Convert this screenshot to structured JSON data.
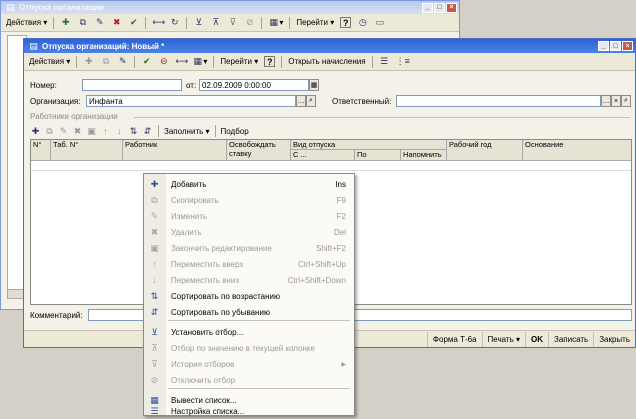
{
  "back_window": {
    "title": "Отпуска организации",
    "actions_label": "Действия",
    "goto_label": "Перейти"
  },
  "front_window": {
    "title": "Отпуска организаций: Новый *",
    "actions_label": "Действия",
    "goto_label": "Перейти",
    "open_accruals_label": "Открыть начисления",
    "number_label": "Номер:",
    "number_value": "",
    "date_prefix": "от:",
    "date_value": "02.09.2009  0:00:00",
    "org_label": "Организация:",
    "org_value": "Инфанта",
    "responsible_label": "Ответственный:",
    "responsible_value": "",
    "section_label": "Работники организации",
    "fill_label": "Заполнить",
    "select_label": "Подбор",
    "columns": {
      "num": "N°",
      "tab": "Таб. N°",
      "worker": "Работник",
      "free": "Освобождать ставку",
      "vacation_type": "Вид отпуска",
      "from": "С ...",
      "to": "По",
      "remind": "Напомнить",
      "work_year": "Рабочий год",
      "basis": "Основание"
    },
    "comment_label": "Комментарий:",
    "comment_value": "",
    "status": {
      "form": "Форма Т-6а",
      "print": "Печать",
      "ok": "OK",
      "write": "Записать",
      "close": "Закрыть"
    }
  },
  "menu": {
    "items": [
      {
        "label": "Добавить",
        "key": "Ins",
        "icon": "add-icon",
        "disabled": false
      },
      {
        "label": "Скопировать",
        "key": "F9",
        "icon": "copy-icon",
        "disabled": true
      },
      {
        "label": "Изменить",
        "key": "F2",
        "icon": "edit-icon",
        "disabled": true
      },
      {
        "label": "Удалить",
        "key": "Del",
        "icon": "delete-icon",
        "disabled": true
      },
      {
        "label": "Закончить редактирование",
        "key": "Shift+F2",
        "icon": "finish-edit-icon",
        "disabled": true
      },
      {
        "label": "Переместить вверх",
        "key": "Ctrl+Shift+Up",
        "icon": "arrow-up-icon",
        "disabled": true
      },
      {
        "label": "Переместить вниз",
        "key": "Ctrl+Shift+Down",
        "icon": "arrow-down-icon",
        "disabled": true
      },
      {
        "label": "Сортировать по возрастанию",
        "key": "",
        "icon": "sort-asc-icon",
        "disabled": false
      },
      {
        "label": "Сортировать по убыванию",
        "key": "",
        "icon": "sort-desc-icon",
        "disabled": false
      },
      {
        "label": "Установить отбор...",
        "key": "",
        "icon": "filter-icon",
        "disabled": false
      },
      {
        "label": "Отбор по значению в текущей колонке",
        "key": "",
        "icon": "filter-value-icon",
        "disabled": true
      },
      {
        "label": "История отборов",
        "key": "",
        "icon": "filter-history-icon",
        "disabled": true
      },
      {
        "label": "Отключить отбор",
        "key": "",
        "icon": "filter-off-icon",
        "disabled": true
      },
      {
        "label": "Вывести список...",
        "key": "",
        "icon": "list-output-icon",
        "disabled": false
      },
      {
        "label": "Настройка списка...",
        "key": "",
        "icon": "list-settings-icon",
        "disabled": false
      }
    ]
  }
}
